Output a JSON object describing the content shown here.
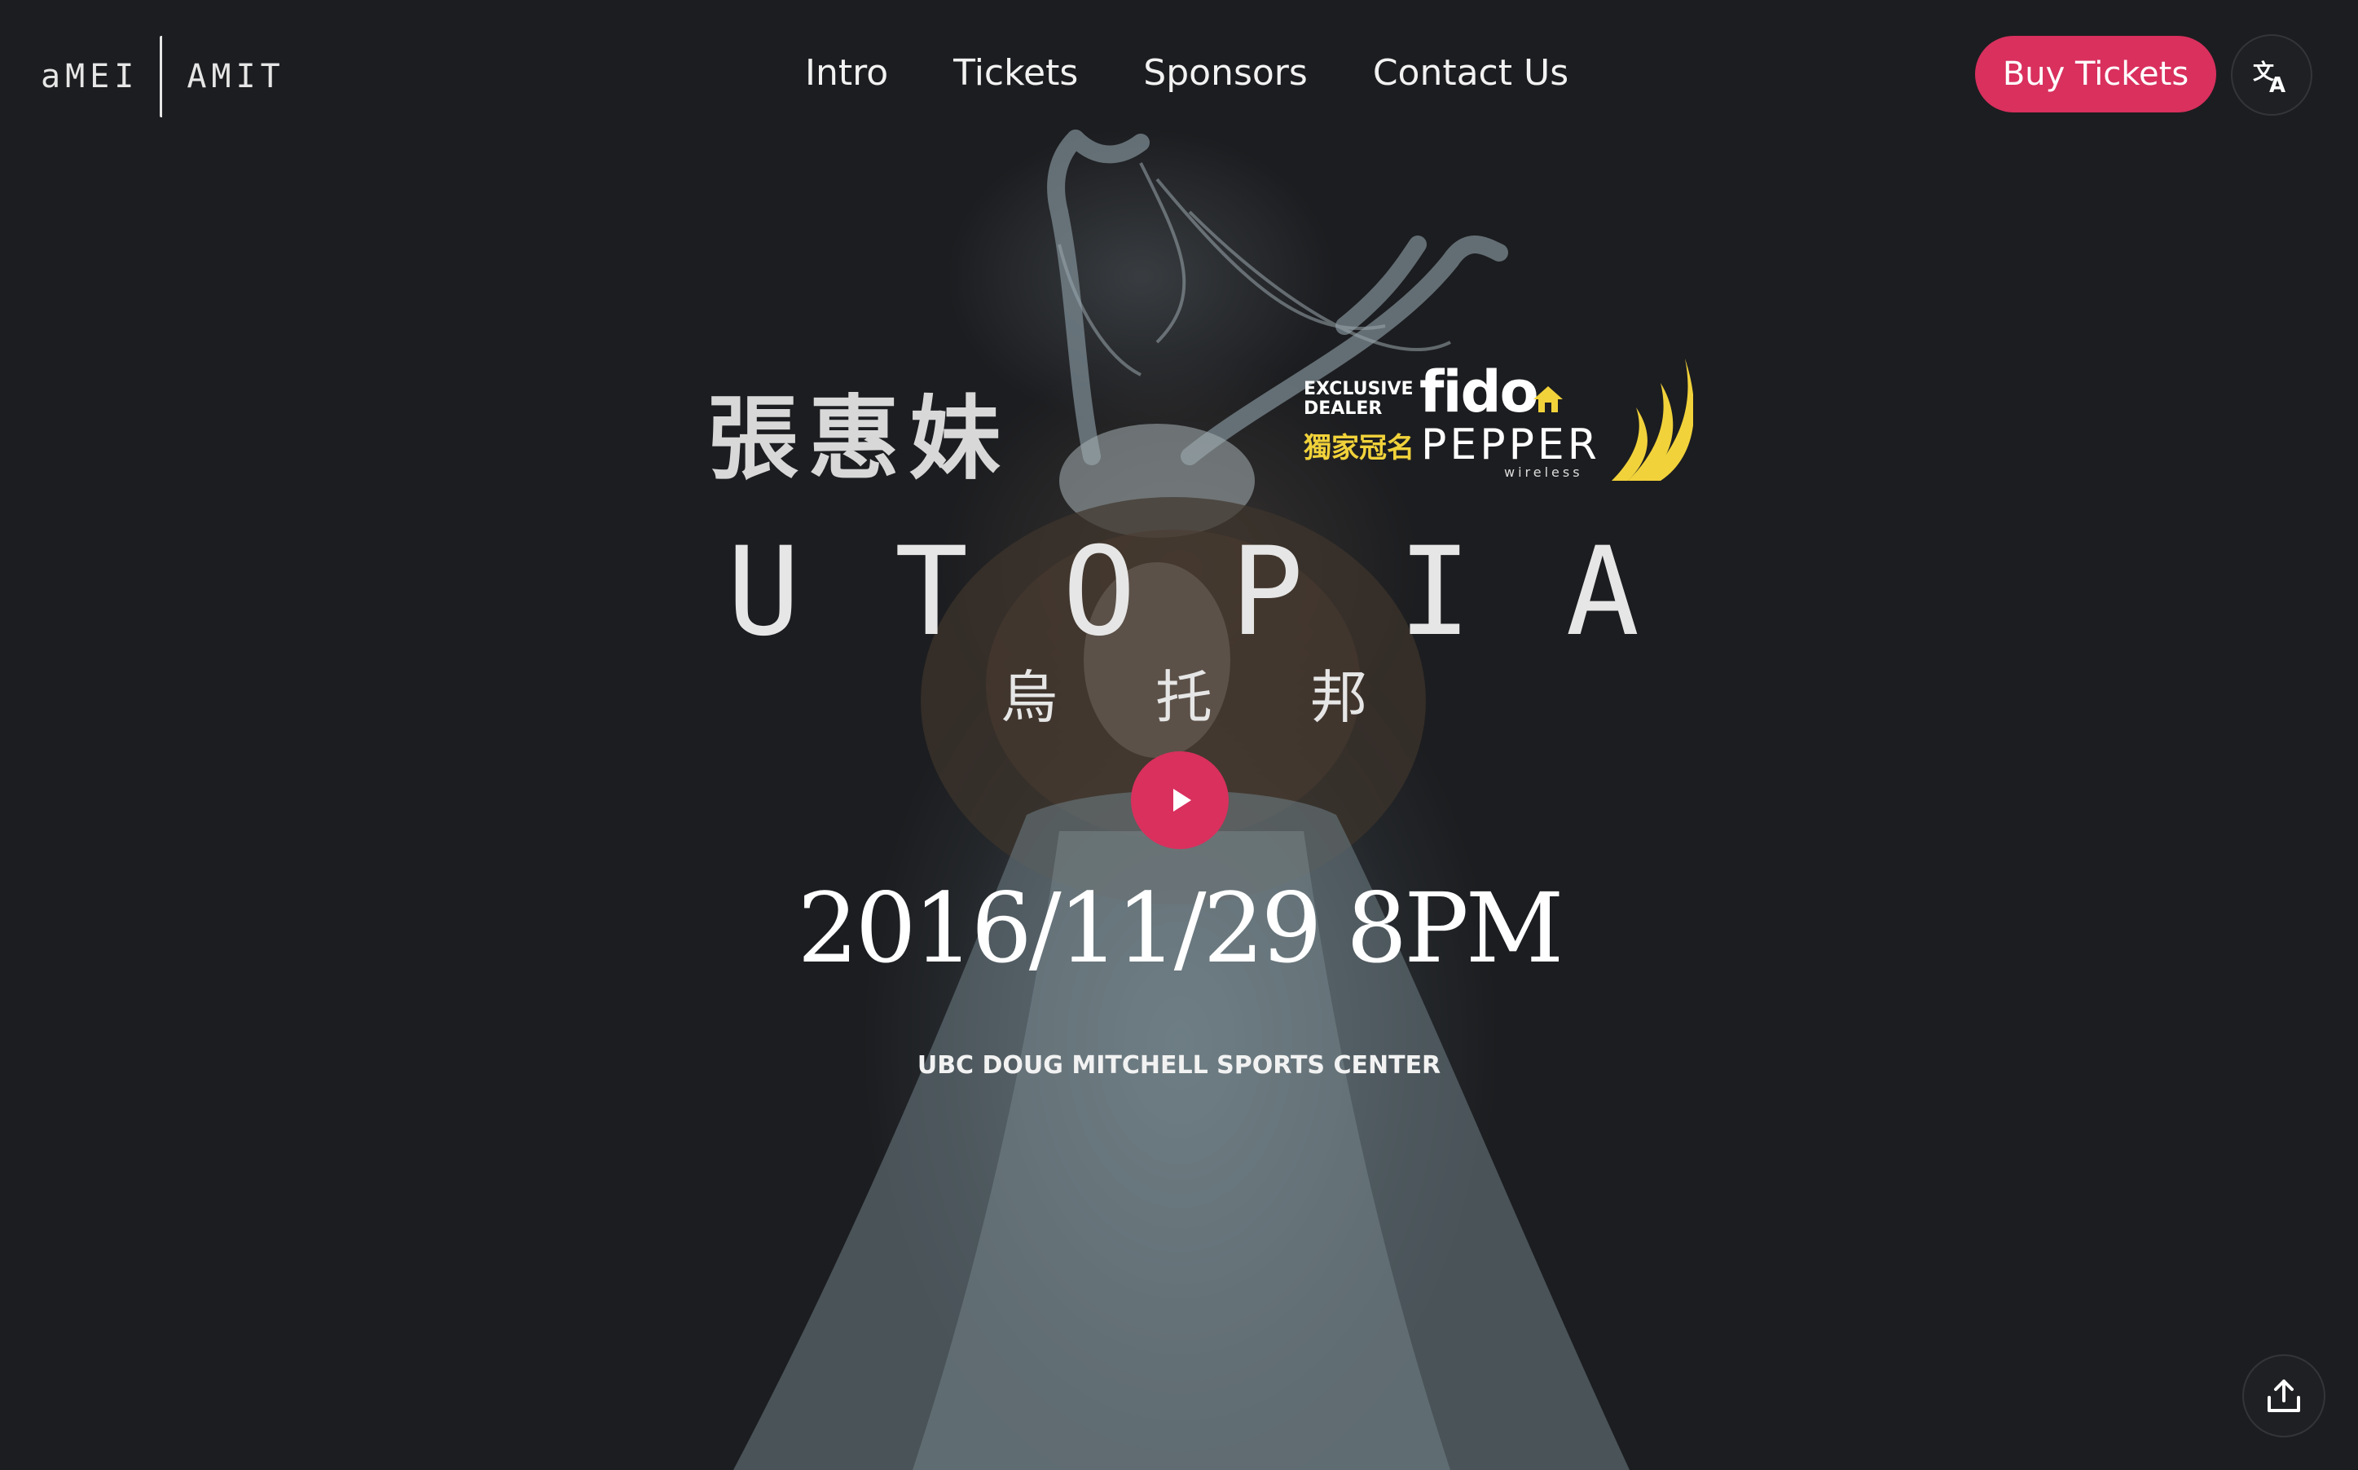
{
  "header": {
    "logo_left": "aMEI",
    "logo_right": "AMIT",
    "nav": [
      "Intro",
      "Tickets",
      "Sponsors",
      "Contact Us"
    ],
    "buy_tickets_label": "Buy Tickets",
    "language_icon": "translate-icon"
  },
  "hero": {
    "artist_name": "張惠妹",
    "sponsor": {
      "exclusive": "EXCLUSIVE",
      "dealer": "DEALER",
      "fido": "fido",
      "chinese": "獨家冠名",
      "pepper": "PEPPER",
      "wireless": "wireless"
    },
    "utopia_letters": [
      "U",
      "T",
      "O",
      "P",
      "I",
      "A"
    ],
    "utopia_chinese": [
      "烏",
      "托",
      "邦"
    ],
    "play_icon": "play-icon",
    "date": "2016/11/29 8PM",
    "venue": "UBC DOUG MITCHELL SPORTS CENTER"
  },
  "footer": {
    "share_icon": "share-upload-icon"
  },
  "colors": {
    "accent": "#d9305e",
    "background": "#1c1d20",
    "sponsor_yellow": "#f1d23a"
  }
}
